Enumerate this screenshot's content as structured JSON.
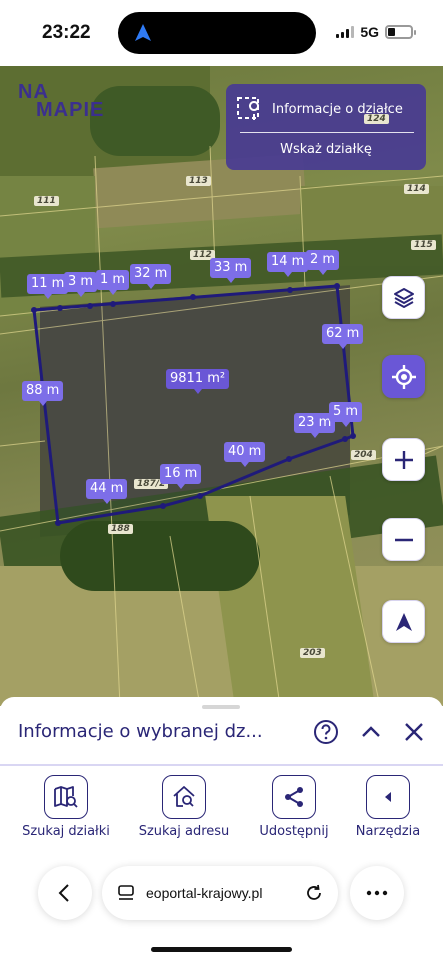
{
  "status_bar": {
    "time": "23:22",
    "network": "5G",
    "battery_level": 0.3
  },
  "map": {
    "logo_line1": "NA",
    "logo_line2": "MAPIE",
    "info_panel": {
      "title": "Informacje o działce",
      "action": "Wskaż działkę"
    },
    "plot_numbers": [
      "111",
      "113",
      "114",
      "112",
      "115",
      "124",
      "204",
      "188",
      "187/2",
      "203"
    ],
    "measurements": [
      {
        "id": "m11",
        "text": "11 m"
      },
      {
        "id": "m3",
        "text": "3 m"
      },
      {
        "id": "m1",
        "text": "1 m"
      },
      {
        "id": "m32",
        "text": "32 m"
      },
      {
        "id": "m33",
        "text": "33 m"
      },
      {
        "id": "m14",
        "text": "14 m"
      },
      {
        "id": "m2",
        "text": "2 m"
      },
      {
        "id": "m62",
        "text": "62 m"
      },
      {
        "id": "m88",
        "text": "88 m"
      },
      {
        "id": "m23",
        "text": "23 m"
      },
      {
        "id": "m5",
        "text": "5 m"
      },
      {
        "id": "m40",
        "text": "40 m"
      },
      {
        "id": "m16",
        "text": "16 m"
      },
      {
        "id": "m44",
        "text": "44 m"
      }
    ],
    "area": "9811 m²"
  },
  "sheet": {
    "title": "Informacje o wybranej dz...",
    "tools": [
      {
        "label": "Szukaj działki",
        "icon": "map-search-icon"
      },
      {
        "label": "Szukaj adresu",
        "icon": "home-search-icon"
      },
      {
        "label": "Udostępnij",
        "icon": "share-icon"
      },
      {
        "label": "Narzędzia",
        "icon": "chevron-left-icon"
      }
    ]
  },
  "browser": {
    "url": "eoportal-krajowy.pl"
  },
  "colors": {
    "accent": "#6a57d6",
    "navy": "#2a2676",
    "boundary": "#1f1a7a"
  }
}
